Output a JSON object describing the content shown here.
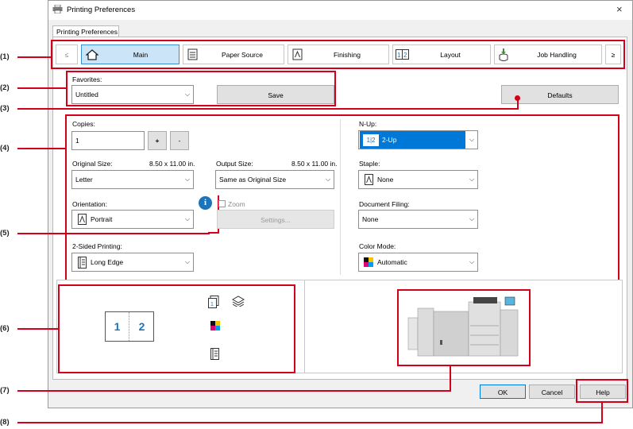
{
  "window": {
    "title": "Printing Preferences",
    "close": "×"
  },
  "tab": {
    "label": "Printing Preferences"
  },
  "categories": {
    "prev": "≤",
    "next": "≥",
    "items": [
      "Main",
      "Paper Source",
      "Finishing",
      "Layout",
      "Job Handling"
    ]
  },
  "favorites": {
    "label": "Favorites:",
    "value": "Untitled",
    "save": "Save",
    "defaults": "Defaults"
  },
  "copies": {
    "label": "Copies:",
    "value": "1",
    "plus": "+",
    "minus": "-"
  },
  "original_size": {
    "label": "Original Size:",
    "dims": "8.50 x 11.00 in.",
    "value": "Letter"
  },
  "output_size": {
    "label": "Output Size:",
    "dims": "8.50 x 11.00 in.",
    "value": "Same as Original Size"
  },
  "orientation": {
    "label": "Orientation:",
    "value": "Portrait"
  },
  "zoom": {
    "label": "Zoom",
    "settings": "Settings..."
  },
  "two_sided": {
    "label": "2-Sided Printing:",
    "value": "Long Edge"
  },
  "nup": {
    "label": "N-Up:",
    "value": "2-Up",
    "icon_text": "1|2"
  },
  "staple": {
    "label": "Staple:",
    "value": "None"
  },
  "document_filing": {
    "label": "Document Filing:",
    "value": "None"
  },
  "color_mode": {
    "label": "Color Mode:",
    "value": "Automatic"
  },
  "preview": {
    "page1": "1",
    "page2": "2"
  },
  "footer": {
    "ok": "OK",
    "cancel": "Cancel",
    "help": "Help"
  },
  "callouts": [
    "(1)",
    "(2)",
    "(3)",
    "(4)",
    "(5)",
    "(6)",
    "(7)",
    "(8)"
  ],
  "colors": {
    "accent": "#0078d7",
    "callout_red": "#d4001a",
    "selected_bg": "#cce4f7"
  }
}
